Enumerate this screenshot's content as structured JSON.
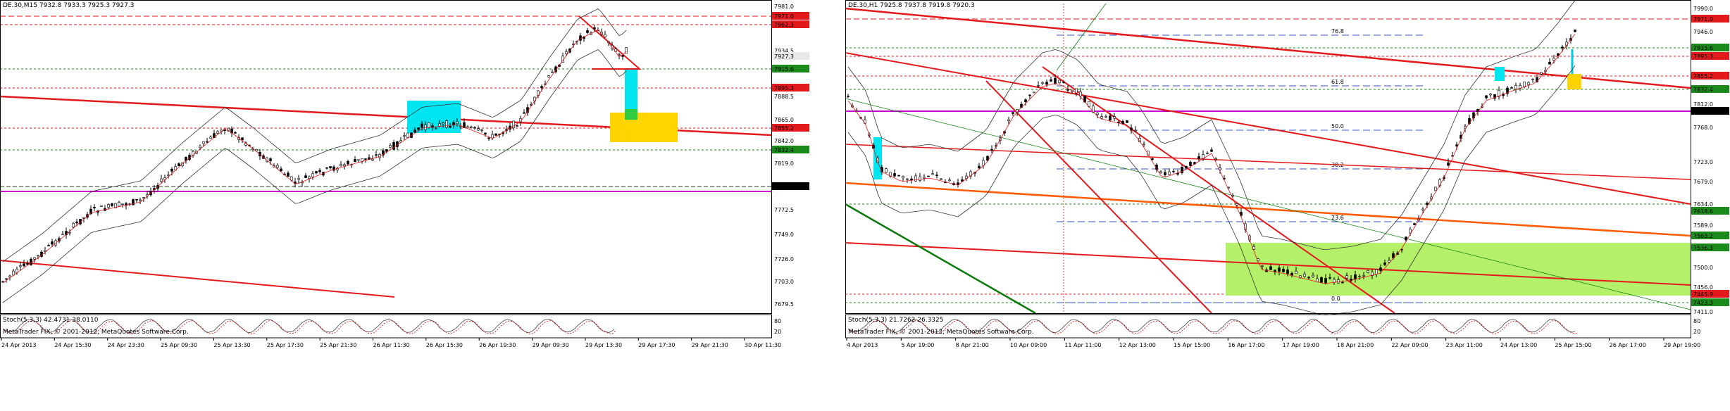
{
  "left": {
    "header": "DE.30,M15  7932.8 7933.3 7925.3 7927.3",
    "price_labels": [
      {
        "text": "7981.0",
        "bg": "#ffffff",
        "fg": "#000"
      },
      {
        "text": "7971.0",
        "bg": "#e31a1c",
        "fg": "#fff"
      },
      {
        "text": "7962.3",
        "bg": "#e31a1c",
        "fg": "#fff"
      },
      {
        "text": "7934.5",
        "bg": "#ffffff",
        "fg": "#000"
      },
      {
        "text": "7927.3",
        "bg": "#e8e8e8",
        "fg": "#000"
      },
      {
        "text": "7915.6",
        "bg": "#1a8a1a",
        "fg": "#fff"
      },
      {
        "text": "7895.3",
        "bg": "#e31a1c",
        "fg": "#fff"
      },
      {
        "text": "7888.5",
        "bg": "#ffffff",
        "fg": "#000"
      },
      {
        "text": "7865.0",
        "bg": "#ffffff",
        "fg": "#000"
      },
      {
        "text": "7855.2",
        "bg": "#e31a1c",
        "fg": "#fff"
      },
      {
        "text": "7842.0",
        "bg": "#ffffff",
        "fg": "#000"
      },
      {
        "text": "7832.4",
        "bg": "#1a8a1a",
        "fg": "#fff"
      },
      {
        "text": "7819.0",
        "bg": "#ffffff",
        "fg": "#000"
      },
      {
        "text": "7793.9",
        "bg": "#000000",
        "fg": "#fff"
      },
      {
        "text": "7772.5",
        "bg": "#ffffff",
        "fg": "#000"
      },
      {
        "text": "7749.0",
        "bg": "#ffffff",
        "fg": "#000"
      },
      {
        "text": "7726.0",
        "bg": "#ffffff",
        "fg": "#000"
      },
      {
        "text": "7703.0",
        "bg": "#ffffff",
        "fg": "#000"
      },
      {
        "text": "7679.5",
        "bg": "#ffffff",
        "fg": "#000"
      }
    ],
    "stoch_label": "Stoch(5,3,3) 42.4731 38.0110",
    "copyright": "MetaTrader FIX, © 2001-2012, MetaQuotes Software Corp.",
    "stoch_levels": [
      "80",
      "20"
    ],
    "time_labels": [
      "24 Apr 2013",
      "24 Apr 15:30",
      "24 Apr 23:30",
      "25 Apr 09:30",
      "25 Apr 13:30",
      "25 Apr 17:30",
      "25 Apr 21:30",
      "26 Apr 11:30",
      "26 Apr 15:30",
      "26 Apr 19:30",
      "29 Apr 09:30",
      "29 Apr 13:30",
      "29 Apr 17:30",
      "29 Apr 21:30",
      "30 Apr 11:30"
    ]
  },
  "right": {
    "header": "DE.30,H1  7925.8 7937.8 7919.8 7920.3",
    "price_labels": [
      {
        "text": "7990.0",
        "bg": "#ffffff",
        "fg": "#000"
      },
      {
        "text": "7971.0",
        "bg": "#e31a1c",
        "fg": "#fff"
      },
      {
        "text": "7946.0",
        "bg": "#ffffff",
        "fg": "#000"
      },
      {
        "text": "7915.6",
        "bg": "#1a8a1a",
        "fg": "#fff"
      },
      {
        "text": "7895.3",
        "bg": "#e31a1c",
        "fg": "#fff"
      },
      {
        "text": "7855.2",
        "bg": "#e31a1c",
        "fg": "#fff"
      },
      {
        "text": "7832.4",
        "bg": "#1a8a1a",
        "fg": "#fff"
      },
      {
        "text": "7812.0",
        "bg": "#ffffff",
        "fg": "#000"
      },
      {
        "text": "7793.9",
        "bg": "#000000",
        "fg": "#fff"
      },
      {
        "text": "7768.0",
        "bg": "#ffffff",
        "fg": "#000"
      },
      {
        "text": "7723.0",
        "bg": "#ffffff",
        "fg": "#000"
      },
      {
        "text": "7679.0",
        "bg": "#ffffff",
        "fg": "#000"
      },
      {
        "text": "7634.0",
        "bg": "#ffffff",
        "fg": "#000"
      },
      {
        "text": "7618.6",
        "bg": "#1a8a1a",
        "fg": "#fff"
      },
      {
        "text": "7589.0",
        "bg": "#ffffff",
        "fg": "#000"
      },
      {
        "text": "7563.2",
        "bg": "#1a8a1a",
        "fg": "#fff"
      },
      {
        "text": "7536.3",
        "bg": "#1a8a1a",
        "fg": "#fff"
      },
      {
        "text": "7500.0",
        "bg": "#ffffff",
        "fg": "#000"
      },
      {
        "text": "7456.0",
        "bg": "#ffffff",
        "fg": "#000"
      },
      {
        "text": "7445.9",
        "bg": "#e31a1c",
        "fg": "#fff"
      },
      {
        "text": "7423.3",
        "bg": "#1a8a1a",
        "fg": "#fff"
      },
      {
        "text": "7411.0",
        "bg": "#ffffff",
        "fg": "#000"
      }
    ],
    "fib_labels": [
      "76.8",
      "61.8",
      "50.0",
      "38.2",
      "23.6",
      "0.0"
    ],
    "stoch_label": "Stoch(5,3,3) 21.7262 26.3325",
    "copyright": "MetaTrader FIX, © 2001-2012, MetaQuotes Software Corp.",
    "stoch_levels": [
      "80",
      "20"
    ],
    "time_labels": [
      "4 Apr 2013",
      "5 Apr 19:00",
      "8 Apr 21:00",
      "10 Apr 09:00",
      "11 Apr 11:00",
      "12 Apr 13:00",
      "15 Apr 15:00",
      "16 Apr 17:00",
      "17 Apr 19:00",
      "18 Apr 21:00",
      "22 Apr 09:00",
      "23 Apr 11:00",
      "24 Apr 13:00",
      "25 Apr 15:00",
      "26 Apr 17:00",
      "29 Apr 19:00"
    ]
  }
}
